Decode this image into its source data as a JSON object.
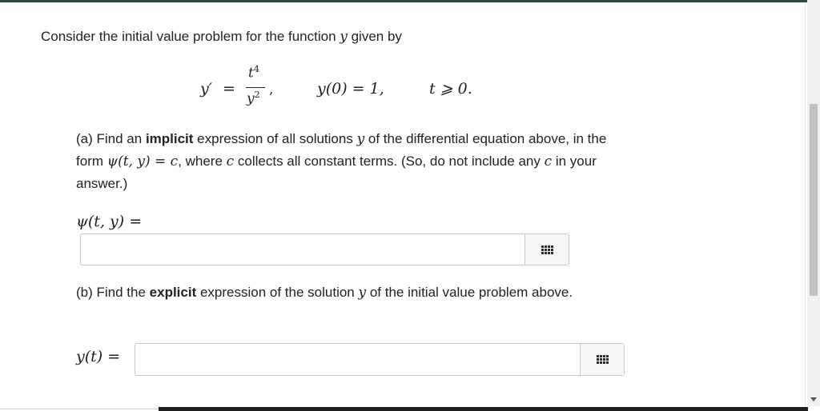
{
  "question": {
    "intro_prefix": "Consider the initial value problem for the function ",
    "intro_var": "y",
    "intro_suffix": " given by",
    "equation": {
      "lhs": "y′",
      "equals": "=",
      "numerator_base": "t",
      "numerator_exp": "4",
      "denominator_base": "y",
      "denominator_exp": "2",
      "comma": ",",
      "initial_condition": "y(0) = 1,",
      "domain": "t ⩾ 0."
    }
  },
  "part_a": {
    "text_1": "(a) Find an ",
    "bold": "implicit",
    "text_2": " expression of all solutions ",
    "var_y": "y",
    "text_3": " of the differential equation above, in the form ",
    "form": "ψ(t, y) = c",
    "text_4": ", where ",
    "var_c": "c",
    "text_5": " collects all constant terms. (So, do not include any ",
    "var_c2": "c",
    "text_6": " in your answer.)",
    "answer_label": "ψ(t, y) =",
    "answer_value": "",
    "keypad_icon": "keypad-grid-icon"
  },
  "part_b": {
    "text_1": "(b) Find the ",
    "bold": "explicit",
    "text_2": " expression of the solution ",
    "var_y": "y",
    "text_3": " of the initial value problem above.",
    "answer_label": "y(t) =",
    "answer_value": "",
    "keypad_icon": "keypad-grid-icon"
  },
  "colors": {
    "top_rule": "#2f4a3e",
    "field_border": "#c8c8c8",
    "text": "#222222"
  }
}
